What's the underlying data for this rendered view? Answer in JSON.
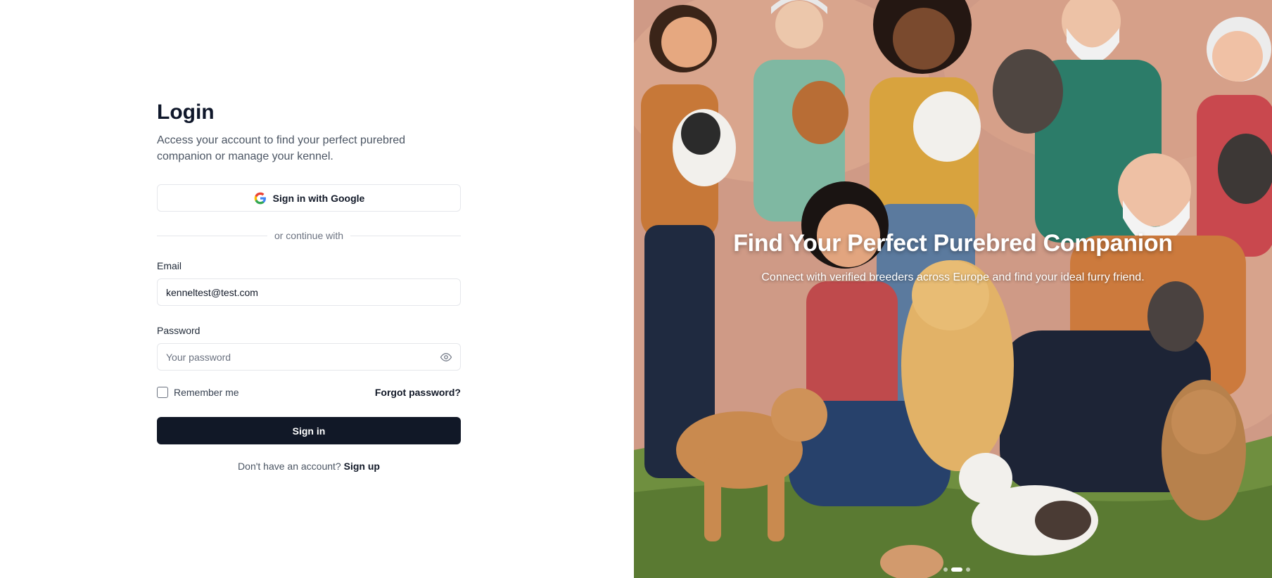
{
  "login": {
    "title": "Login",
    "subtitle": "Access your account to find your perfect purebred companion or manage your kennel.",
    "google_button": "Sign in with Google",
    "divider_text": "or continue with",
    "email_label": "Email",
    "email_value": "kenneltest@test.com",
    "password_label": "Password",
    "password_placeholder": "Your password",
    "remember_label": "Remember me",
    "forgot_link": "Forgot password?",
    "signin_button": "Sign in",
    "signup_prompt": "Don't have an account?",
    "signup_link": "Sign up"
  },
  "hero": {
    "title": "Find Your Perfect Purebred Companion",
    "subtitle": "Connect with verified breeders across Europe and find your ideal furry friend.",
    "carousel_active_index": 1,
    "carousel_count": 3
  },
  "colors": {
    "primary_button": "#111827",
    "hero_background": "#cf9a86"
  },
  "icons": [
    "google-icon",
    "eye-icon",
    "checkbox-icon"
  ]
}
